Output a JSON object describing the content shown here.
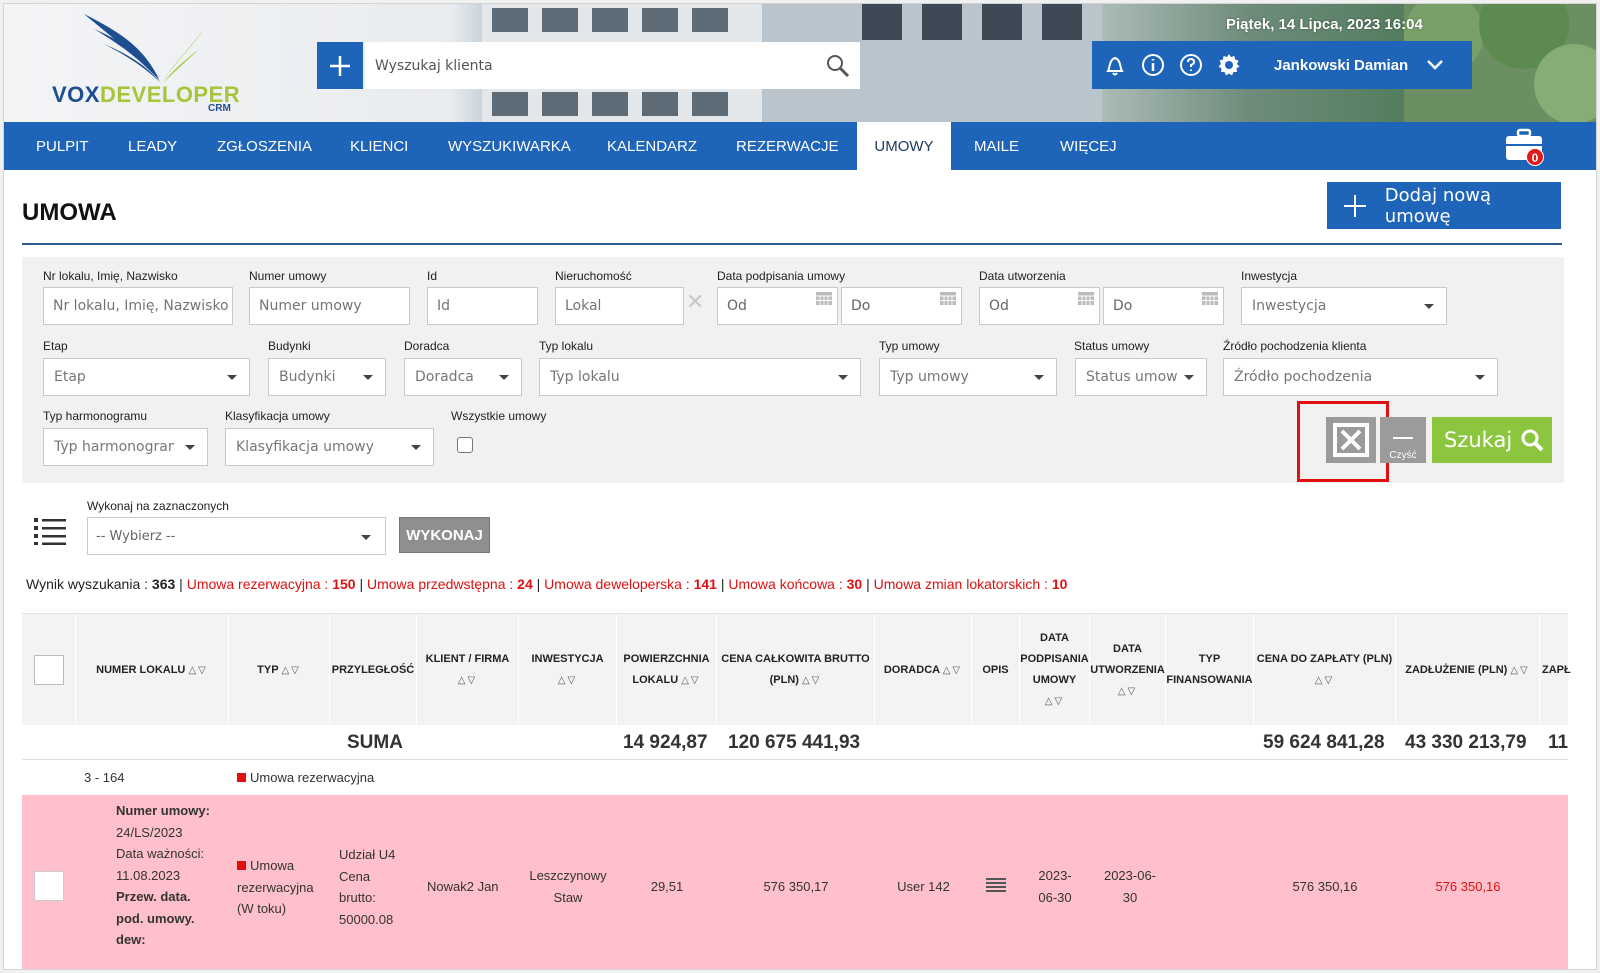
{
  "header": {
    "logo_brand_a": "VOX",
    "logo_brand_b": "DEVELOPER",
    "logo_sub": "CRM",
    "search_placeholder": "Wyszukaj klienta",
    "datetime": "Piątek, 14 Lipca, 2023   16:04",
    "user_name": "Jankowski Damian",
    "cart_count": "0"
  },
  "nav": {
    "items": [
      "PULPIT",
      "LEADY",
      "ZGŁOSZENIA",
      "KLIENCI",
      "WYSZUKIWARKA",
      "KALENDARZ",
      "REZERWACJE",
      "UMOWY",
      "MAILE",
      "WIĘCEJ"
    ],
    "active": "UMOWY"
  },
  "page": {
    "title": "UMOWA",
    "add_button": "Dodaj nową umowę"
  },
  "filters": {
    "row1": {
      "nr_label": "Nr lokalu, Imię, Nazwisko",
      "nr_placeholder": "Nr lokalu, Imię, Nazwisko",
      "num_label": "Numer umowy",
      "num_placeholder": "Numer umowy",
      "id_label": "Id",
      "id_placeholder": "Id",
      "prop_label": "Nieruchomość",
      "prop_placeholder": "Lokal",
      "sign_label": "Data podpisania umowy",
      "from": "Od",
      "to": "Do",
      "created_label": "Data utworzenia",
      "inv_label": "Inwestycja",
      "inv_placeholder": "Inwestycja"
    },
    "row2": {
      "etap_label": "Etap",
      "etap_value": "Etap",
      "bud_label": "Budynki",
      "bud_value": "Budynki",
      "dor_label": "Doradca",
      "dor_value": "Doradca",
      "typl_label": "Typ lokalu",
      "typl_value": "Typ lokalu",
      "typu_label": "Typ umowy",
      "typu_value": "Typ umowy",
      "stat_label": "Status umowy",
      "stat_value": "Status umowy",
      "src_label": "Źródło pochodzenia klienta",
      "src_value": "Źródło pochodzenia"
    },
    "row3": {
      "harm_label": "Typ harmonogramu",
      "harm_value": "Typ harmonogramu",
      "klas_label": "Klasyfikacja umowy",
      "klas_value": "Klasyfikacja umowy",
      "all_label": "Wszystkie umowy"
    },
    "clear_label": "Czyść",
    "search_label": "Szukaj"
  },
  "bulk": {
    "label": "Wykonaj na zaznaczonych",
    "select_value": "-- Wybierz --",
    "exec_label": "WYKONAJ"
  },
  "summary": {
    "label": "Wynik wyszukania : ",
    "total": "363",
    "items": [
      {
        "name": "Umowa rezerwacyjna : ",
        "count": "150"
      },
      {
        "name": "Umowa przedwstępna : ",
        "count": "24"
      },
      {
        "name": "Umowa deweloperska : ",
        "count": "141"
      },
      {
        "name": "Umowa końcowa : ",
        "count": "30"
      },
      {
        "name": "Umowa zmian lokatorskich : ",
        "count": "10"
      }
    ]
  },
  "table": {
    "headers": {
      "numer": "NUMER LOKALU",
      "typ": "TYP",
      "przyl": "PRZYLEGŁOŚĆ",
      "klient": "KLIENT / FIRMA",
      "inw": "INWESTYCJA",
      "pow_a": "POWIERZCHNIA",
      "pow_b": "LOKALU",
      "cena_a": "CENA CAŁKOWITA BRUTTO",
      "cena_b": "(PLN)",
      "dor": "DORADCA",
      "opis": "OPIS",
      "dp_a": "DATA",
      "dp_b": "PODPISANIA",
      "dp_c": "UMOWY",
      "du_a": "DATA",
      "du_b": "UTWORZENIA",
      "tf_a": "TYP",
      "tf_b": "FINANSOWANIA",
      "cdz": "CENA DO ZAPŁATY (PLN)",
      "zad": "ZADŁUŻENIE (PLN)",
      "zap": "ZAPŁ"
    },
    "sum": {
      "label": "SUMA",
      "area": "14 924,87",
      "gross": "120 675 441,93",
      "to_pay": "59 624 841,28",
      "debt": "43 330 213,79",
      "next": "11"
    },
    "group": {
      "unit": "3 - 164",
      "type": "Umowa rezerwacyjna"
    },
    "row": {
      "num_label": "Numer umowy:",
      "num_value": "24/LS/2023",
      "valid_label": "Data ważności:",
      "valid_value": "11.08.2023",
      "przew_a": "Przew. data.",
      "przew_b": "pod. umowy.",
      "przew_c": "dew:",
      "typ_a": "Umowa",
      "typ_b": "rezerwacyjna",
      "typ_c": "(W toku)",
      "przyl_a": "Udział U4",
      "przyl_b": "Cena",
      "przyl_c": "brutto:",
      "przyl_d": "50000.08",
      "klient": "Nowak2 Jan",
      "inw_a": "Leszczynowy",
      "inw_b": "Staw",
      "pow": "29,51",
      "cena": "576 350,17",
      "dor": "User 142",
      "dp_a": "2023-",
      "dp_b": "06-30",
      "du_a": "2023-06-",
      "du_b": "30",
      "cdz": "576 350,16",
      "zad": "576 350,16"
    }
  }
}
